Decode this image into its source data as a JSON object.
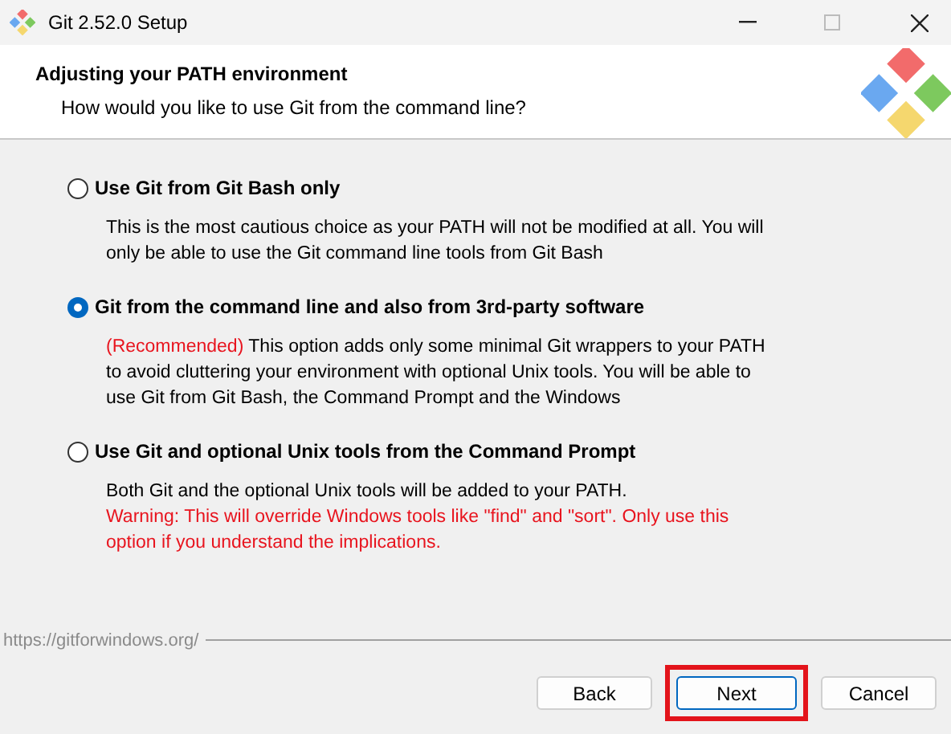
{
  "window": {
    "title": "Git 2.52.0 Setup"
  },
  "header": {
    "title": "Adjusting your PATH environment",
    "subtitle": "How would you like to use Git from the command line?"
  },
  "options": [
    {
      "label": "Use Git from Git Bash only",
      "selected": false,
      "description": "This is the most cautious choice as your PATH will not be modified at all. You will only be able to use the Git command line tools from Git Bash"
    },
    {
      "label": "Git from the command line and also from 3rd-party software",
      "selected": true,
      "note": "(Recommended)",
      "description": "This option adds only some minimal Git wrappers to your PATH to avoid cluttering your environment with optional Unix tools. You will be able to use Git from Git Bash, the Command Prompt and the Windows"
    },
    {
      "label": "Use Git and optional Unix tools from the Command Prompt",
      "selected": false,
      "description": "Both Git and the optional Unix tools will be added to your PATH.",
      "warning": "Warning: This will override Windows tools like \"find\" and \"sort\". Only use this option if you understand the implications."
    }
  ],
  "footer_link": "https://gitforwindows.org/",
  "buttons": [
    {
      "label": "Back",
      "highlighted": false,
      "focused": false
    },
    {
      "label": "Next",
      "highlighted": true,
      "focused": true
    },
    {
      "label": "Cancel",
      "highlighted": false,
      "focused": false
    }
  ]
}
